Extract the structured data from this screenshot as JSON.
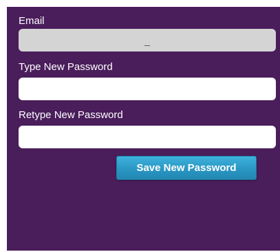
{
  "form": {
    "email": {
      "label": "Email",
      "value": "_"
    },
    "new_password": {
      "label": "Type New Password",
      "value": ""
    },
    "retype_password": {
      "label": "Retype New Password",
      "value": ""
    },
    "save_button": {
      "label": "Save New Password"
    }
  },
  "colors": {
    "panel_background": "#4a1d5b",
    "disabled_field": "#d4d4d4",
    "button_primary": "#2a97c4"
  }
}
